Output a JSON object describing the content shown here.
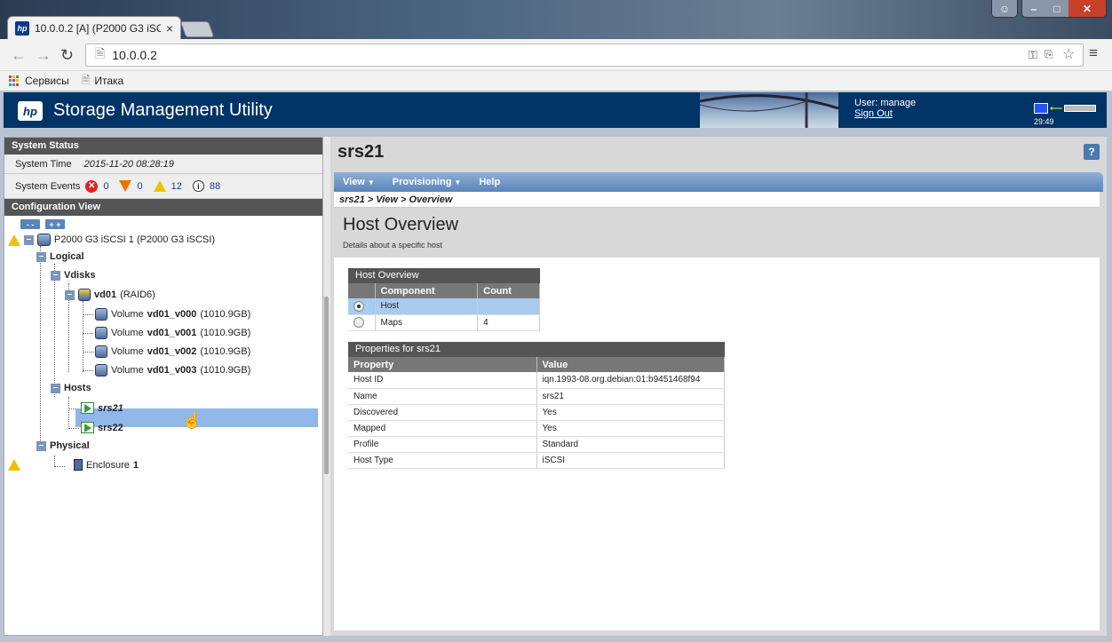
{
  "browser": {
    "tab_title": "10.0.0.2 [A] (P2000 G3 iSC",
    "url": "10.0.0.2",
    "bookmarks": [
      "Сервисы",
      "Итака"
    ]
  },
  "app": {
    "title": "Storage Management Utility",
    "logo_text": "hp",
    "user_label": "User: manage",
    "sign_out": "Sign Out",
    "clock": "29:49"
  },
  "system_status": {
    "heading": "System Status",
    "time_label": "System Time",
    "time_value": "2015-11-20 08:28:19",
    "events_label": "System Events",
    "critical": "0",
    "error": "0",
    "warning": "12",
    "info": "88"
  },
  "config_view": {
    "heading": "Configuration View",
    "collapse_btn": "- -",
    "expand_btn": "+ +",
    "system": "P2000 G3 iSCSI 1 (P2000 G3 iSCSI)",
    "logical": "Logical",
    "vdisks": "Vdisks",
    "vdisk_name": "vd01",
    "vdisk_raid": "(RAID6)",
    "volume_prefix": "Volume",
    "volumes": [
      {
        "name": "vd01_v000",
        "size": "(1010.9GB)"
      },
      {
        "name": "vd01_v001",
        "size": "(1010.9GB)"
      },
      {
        "name": "vd01_v002",
        "size": "(1010.9GB)"
      },
      {
        "name": "vd01_v003",
        "size": "(1010.9GB)"
      }
    ],
    "hosts": "Hosts",
    "host1": "srs21",
    "host2": "srs22",
    "physical": "Physical",
    "enclosure": "Enclosure",
    "enclosure_num": "1"
  },
  "main": {
    "title": "srs21",
    "help": "?",
    "menu": [
      "View",
      "Provisioning",
      "Help"
    ],
    "breadcrumb": "srs21 > View > Overview",
    "section_title": "Host Overview",
    "section_sub": "Details about a specific host",
    "overview_table": {
      "title": "Host Overview",
      "headers": [
        "Component",
        "Count"
      ],
      "rows": [
        {
          "component": "Host",
          "count": ""
        },
        {
          "component": "Maps",
          "count": "4"
        }
      ]
    },
    "props_table": {
      "title": "Properties for srs21",
      "headers": [
        "Property",
        "Value"
      ],
      "rows": [
        {
          "property": "Host ID",
          "value": "iqn.1993-08.org.debian:01:b9451468f94"
        },
        {
          "property": "Name",
          "value": "srs21"
        },
        {
          "property": "Discovered",
          "value": "Yes"
        },
        {
          "property": "Mapped",
          "value": "Yes"
        },
        {
          "property": "Profile",
          "value": "Standard"
        },
        {
          "property": "Host Type",
          "value": "iSCSI"
        }
      ]
    }
  }
}
